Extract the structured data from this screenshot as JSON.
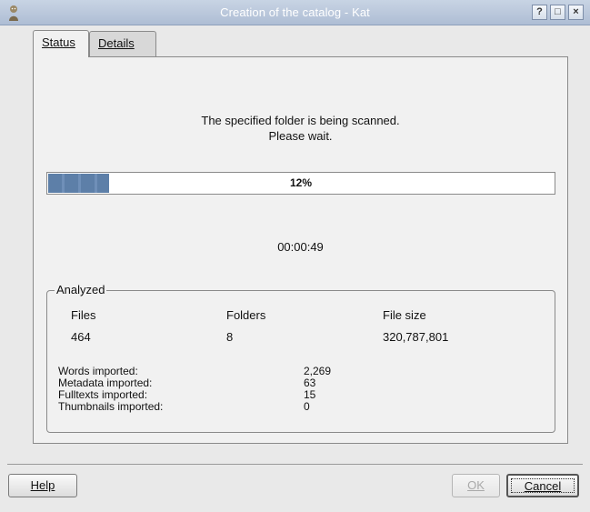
{
  "window": {
    "title": "Creation of the catalog - Kat",
    "buttons": [
      "?",
      "□",
      "×"
    ]
  },
  "tabs": [
    {
      "label": "Status",
      "active": true
    },
    {
      "label": "Details",
      "active": false
    }
  ],
  "status": {
    "message_line1": "The specified folder is being scanned.",
    "message_line2": "Please wait.",
    "progress_value": 12,
    "progress_label": "12%",
    "elapsed": "00:00:49"
  },
  "analyzed": {
    "title": "Analyzed",
    "headers": {
      "files": "Files",
      "folders": "Folders",
      "filesize": "File size"
    },
    "values": {
      "files": "464",
      "folders": "8",
      "filesize": "320,787,801"
    },
    "stats": [
      {
        "label": "Words imported:",
        "value": "2,269"
      },
      {
        "label": "Metadata imported:",
        "value": "63"
      },
      {
        "label": "Fulltexts imported:",
        "value": "15"
      },
      {
        "label": "Thumbnails imported:",
        "value": "0"
      }
    ]
  },
  "footer": {
    "help": "Help",
    "ok": "OK",
    "cancel": "Cancel"
  },
  "colors": {
    "titlebar": "#aebdd4",
    "progress": "#5d7fa8"
  }
}
